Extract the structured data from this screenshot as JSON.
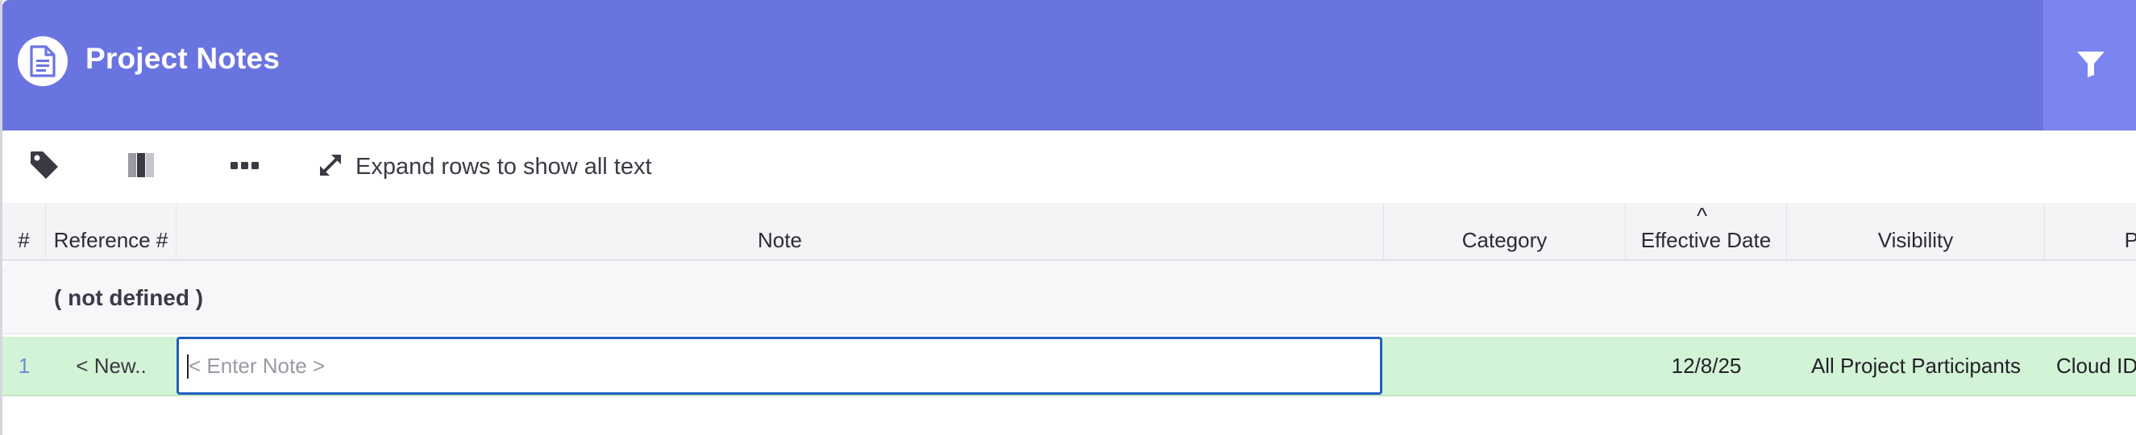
{
  "header": {
    "title": "Project Notes",
    "icon": "document-icon",
    "filter_icon": "filter-icon",
    "accent_color": "#6a74e1"
  },
  "toolbar": {
    "tag_icon": "tag-icon",
    "columns_icon": "columns-icon",
    "more_icon": "more-icon",
    "expand_icon": "expand-icon",
    "expand_label": "Expand rows to show all text"
  },
  "columns": {
    "num": "#",
    "reference": "Reference #",
    "note": "Note",
    "category": "Category",
    "effective_date": "Effective Date",
    "visibility": "Visibility",
    "next": "P"
  },
  "sort_indicator": "^",
  "group": {
    "label": "( not defined )"
  },
  "row": {
    "num": "1",
    "reference": "< New..",
    "note_placeholder": "< Enter Note >",
    "note_value": "",
    "category": "",
    "effective_date": "12/8/25",
    "visibility": "All Project Participants",
    "next": "Cloud ID",
    "highlight_color": "#d3f3d6"
  }
}
